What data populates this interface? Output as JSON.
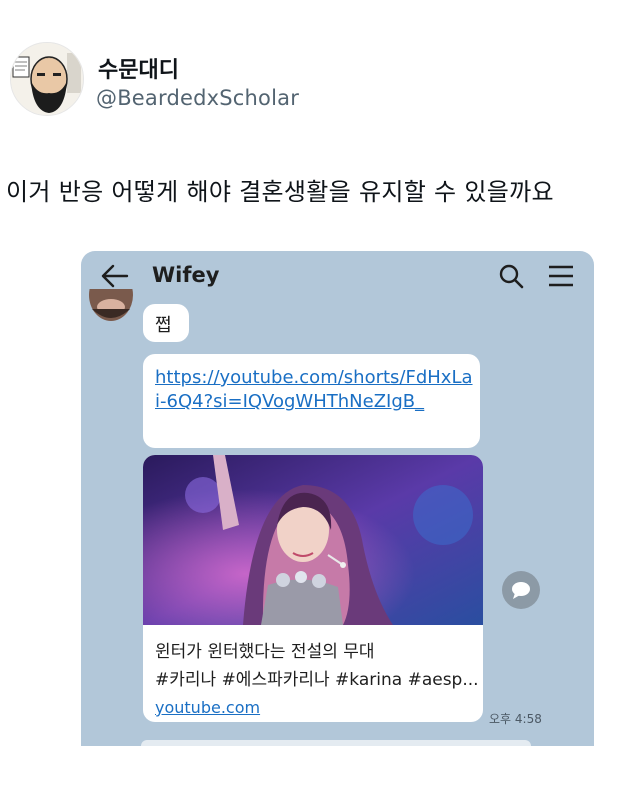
{
  "tweet": {
    "author_name": "수문대디",
    "author_handle": "@BeardedxScholar",
    "text": "이거 반응 어떻게 해야 결혼생활을 유지할 수 있을까요",
    "avatar_icon": "bearded-man-comic-avatar"
  },
  "chat": {
    "title": "Wifey",
    "back_icon": "back-arrow-icon",
    "search_icon": "search-icon",
    "menu_icon": "hamburger-menu-icon",
    "background_color": "#b2c7d9",
    "messages": [
      {
        "text": "쩝"
      },
      {
        "text": "https://youtube.com/shorts/FdHxLai-6Q4?si=IQVogWHThNeZIgB_"
      }
    ],
    "link_preview": {
      "title": "윈터가 윈터했다는 전설의 무대",
      "description": "#카리나 #에스파카리나 #karina #aesp...",
      "domain": "youtube.com"
    },
    "time": "오후 4:58",
    "link_color": "#1a6fc4"
  }
}
